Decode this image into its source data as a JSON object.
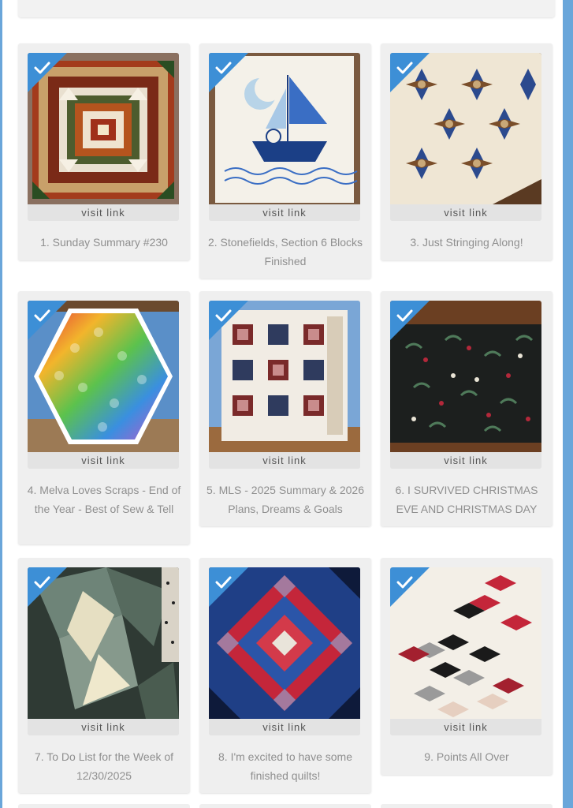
{
  "theme": {
    "check_color": "#3d8fd6",
    "visit_label": "visit link"
  },
  "entries": [
    {
      "caption": "1. Sunday Summary #230",
      "visit_label": "visit link",
      "image": "medallion quilt photo",
      "icon": "check-icon"
    },
    {
      "caption": "2. Stonefields, Section 6 Blocks Finished",
      "visit_label": "visit link",
      "image": "embroidered sailboat block photo",
      "icon": "check-icon"
    },
    {
      "caption": "3. Just Stringing Along!",
      "visit_label": "visit link",
      "image": "blue star quilt photo",
      "icon": "check-icon"
    },
    {
      "caption": "4. Melva Loves Scraps - End of the Year - Best of Sew & Tell",
      "visit_label": "visit link",
      "image": "hexagon scrap quilt photo",
      "icon": "check-icon"
    },
    {
      "caption": "5. MLS - 2025 Summary & 2026 Plans, Dreams & Goals",
      "visit_label": "visit link",
      "image": "log cabin quilt photo",
      "icon": "check-icon"
    },
    {
      "caption": "6. I SURVIVED CHRISTMAS EVE AND CHRISTMAS DAY",
      "visit_label": "visit link",
      "image": "dark floral fabric photo",
      "icon": "check-icon"
    },
    {
      "caption": "7. To Do List for the Week of 12/30/2025",
      "visit_label": "visit link",
      "image": "grey quilt blocks photo",
      "icon": "check-icon"
    },
    {
      "caption": "8. I'm excited to have some finished quilts!",
      "visit_label": "visit link",
      "image": "red and blue triangle quilt photo",
      "icon": "check-icon"
    },
    {
      "caption": "9. Points All Over",
      "visit_label": "visit link",
      "image": "diamond points quilt photo",
      "icon": "check-icon"
    }
  ]
}
